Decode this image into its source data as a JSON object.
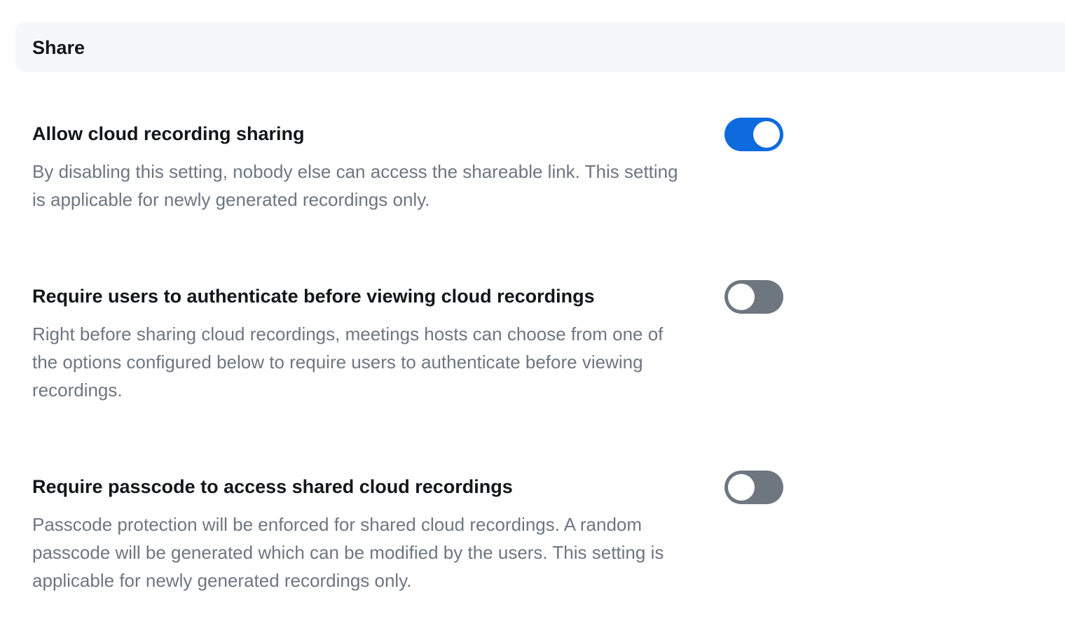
{
  "section": {
    "title": "Share"
  },
  "settings": [
    {
      "title": "Allow cloud recording sharing",
      "description": "By disabling this setting, nobody else can access the shareable link. This setting is applicable for newly generated recordings only.",
      "enabled": true
    },
    {
      "title": "Require users to authenticate before viewing cloud recordings",
      "description": "Right before sharing cloud recordings, meetings hosts can choose from one of the options configured below to require users to authenticate before viewing recordings.",
      "enabled": false
    },
    {
      "title": "Require passcode to access shared cloud recordings",
      "description": "Passcode protection will be enforced for shared cloud recordings. A random passcode will be generated which can be modified by the users. This setting is applicable for newly generated recordings only.",
      "enabled": false
    }
  ],
  "colors": {
    "toggle_on": "#0e6bde",
    "toggle_off": "#6e7680",
    "title_text": "#131619",
    "description_text": "#6e7680",
    "header_background": "#f6f7f9"
  }
}
